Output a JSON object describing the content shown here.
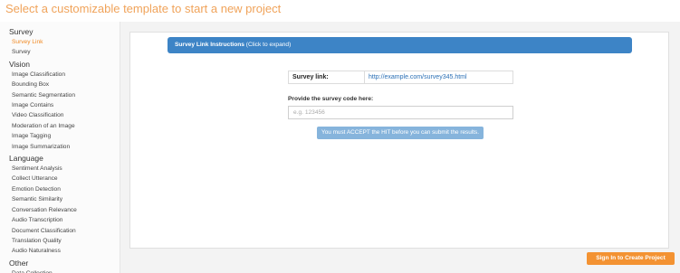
{
  "page": {
    "title": "Select a customizable template to start a new project"
  },
  "sidebar": {
    "categories": [
      {
        "name": "Survey",
        "items": [
          "Survey Link",
          "Survey"
        ]
      },
      {
        "name": "Vision",
        "items": [
          "Image Classification",
          "Bounding Box",
          "Semantic Segmentation",
          "Image Contains",
          "Video Classification",
          "Moderation of an Image",
          "Image Tagging",
          "Image Summarization"
        ]
      },
      {
        "name": "Language",
        "items": [
          "Sentiment Analysis",
          "Collect Utterance",
          "Emotion Detection",
          "Semantic Similarity",
          "Conversation Relevance",
          "Audio Transcription",
          "Document Classification",
          "Translation Quality",
          "Audio Naturalness"
        ]
      },
      {
        "name": "Other",
        "items": [
          "Data Collection"
        ]
      }
    ],
    "active_item": "Survey Link"
  },
  "main": {
    "instructions": {
      "title": "Survey Link Instructions",
      "hint": "(Click to expand)"
    },
    "survey_link": {
      "label": "Survey link:",
      "url": "http://example.com/survey345.html"
    },
    "code": {
      "label": "Provide the survey code here:",
      "placeholder": "e.g. 123456",
      "value": ""
    },
    "accept_notice": "You must ACCEPT the HIT before you can submit the results."
  },
  "actions": {
    "sign_in_label": "Sign In to Create Project"
  },
  "colors": {
    "accent_orange": "#f39232",
    "title_orange": "#f0a35a",
    "header_blue": "#3d84c6",
    "notice_blue": "#86b4dc",
    "link_blue": "#2a6fb5"
  }
}
